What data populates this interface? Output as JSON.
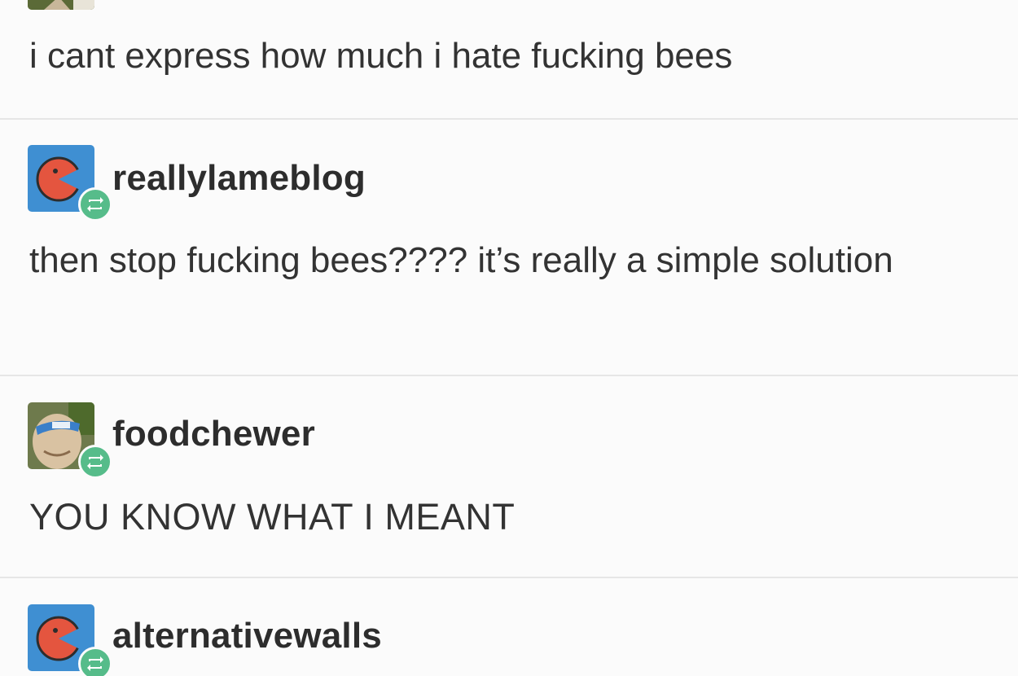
{
  "posts": [
    {
      "username": "",
      "text": "i cant express how much i hate fucking bees",
      "avatar_icon": "landscape-avatar-icon"
    },
    {
      "username": "reallylameblog",
      "text": "then stop fucking bees???? it’s really a simple solution",
      "avatar_icon": "pacman-avatar-icon",
      "badge_icon": "reblog-icon"
    },
    {
      "username": "foodchewer",
      "text": "YOU KNOW WHAT I MEANT",
      "avatar_icon": "sunglasses-face-avatar-icon",
      "badge_icon": "reblog-icon"
    },
    {
      "username": "alternativewalls",
      "text": "",
      "avatar_icon": "pacman-avatar-icon",
      "badge_icon": "reblog-icon"
    }
  ],
  "colors": {
    "background": "#fbfbfb",
    "divider": "#e6e6e6",
    "text": "#333333",
    "reblog_badge": "#56bc8a",
    "avatar_blue": "#3f8fd2",
    "avatar_red": "#e4553f"
  }
}
